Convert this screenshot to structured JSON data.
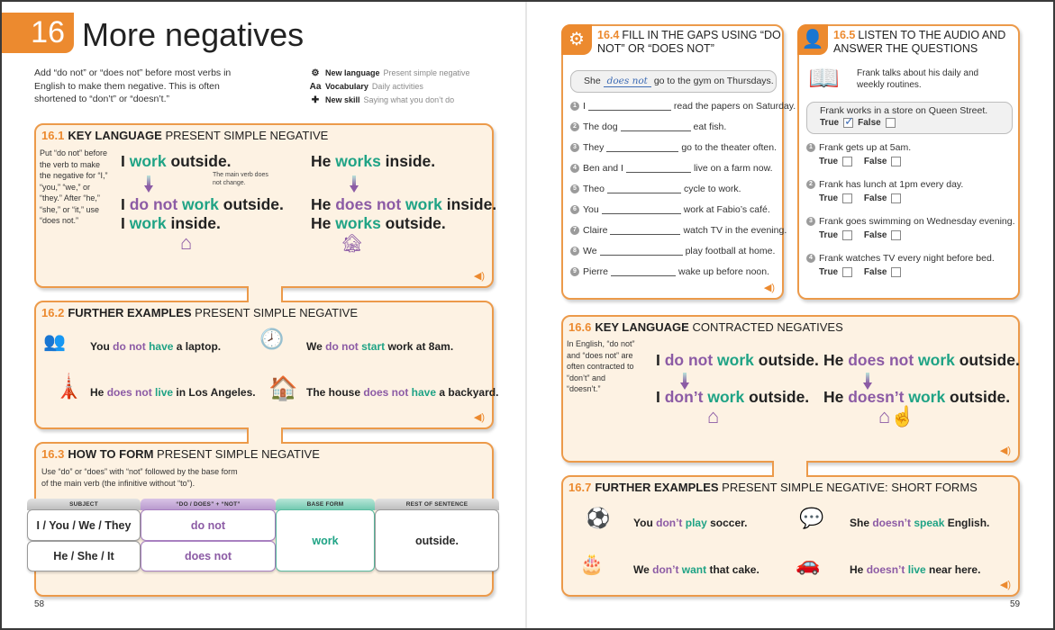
{
  "header": {
    "chapter_number": "16",
    "chapter_title": "More negatives",
    "intro": "Add “do not” or “does not” before most verbs in English to make them negative. This is often shortened to “don’t” or “doesn’t.”",
    "meta": [
      {
        "icon": "gears-icon",
        "glyph": "⚙",
        "label": "New language",
        "value": "Present simple negative"
      },
      {
        "icon": "vocabulary-icon",
        "glyph": "Aa",
        "label": "Vocabulary",
        "value": "Daily activities"
      },
      {
        "icon": "puzzle-icon",
        "glyph": "✚",
        "label": "New skill",
        "value": "Saying what you don’t do"
      }
    ]
  },
  "s161": {
    "num": "16.1",
    "title_bold": "KEY LANGUAGE",
    "title_rest": "PRESENT SIMPLE NEGATIVE",
    "side": "Put “do not” before the verb to make the negative for “I,” “you,” “we,” or “they.” After “he,” “she,” or “it,” use “does not.”",
    "note": "The main verb does not change.",
    "left": {
      "pos": {
        "a": "I ",
        "b": "work",
        "c": " outside."
      },
      "neg": {
        "a": "I ",
        "p": "do not",
        "b": " work",
        "c": " outside."
      },
      "alt": {
        "a": "I ",
        "b": "work",
        "c": " inside."
      }
    },
    "right": {
      "pos": {
        "a": "He ",
        "b": "works",
        "c": " inside."
      },
      "neg": {
        "a": "He ",
        "p": "does not",
        "b": " work",
        "c": " inside."
      },
      "alt": {
        "a": "He ",
        "b": "works",
        "c": " outside."
      }
    }
  },
  "s162": {
    "num": "16.2",
    "title_bold": "FURTHER EXAMPLES",
    "title_rest": "PRESENT SIMPLE NEGATIVE",
    "examples": [
      {
        "icon": "people-laptops-icon",
        "glyph": "👥",
        "a": "You ",
        "p": "do not",
        "g": " have",
        "c": " a laptop."
      },
      {
        "icon": "office-clock-icon",
        "glyph": "🕗",
        "a": "We ",
        "p": "do not",
        "g": " start",
        "c": " work at 8am."
      },
      {
        "icon": "eiffel-tower-icon",
        "glyph": "🗼",
        "a": "He ",
        "p": "does not",
        "g": " live",
        "c": " in Los Angeles."
      },
      {
        "icon": "house-icon",
        "glyph": "🏠",
        "a": "The house ",
        "p": "does not",
        "g": " have",
        "c": " a backyard."
      }
    ]
  },
  "s163": {
    "num": "16.3",
    "title_bold": "HOW TO FORM",
    "title_rest": "PRESENT SIMPLE NEGATIVE",
    "desc": "Use “do” or “does” with “not” followed by the base form of the main verb (the infinitive without “to”).",
    "headers": [
      "SUBJECT",
      "“DO / DOES” + “NOT”",
      "BASE FORM",
      "REST OF SENTENCE"
    ],
    "subjects": [
      "I / You / We / They",
      "He / She / It"
    ],
    "auxiliaries": [
      "do not",
      "does not"
    ],
    "base": "work",
    "rest": "outside."
  },
  "s164": {
    "num": "16.4",
    "title": "FILL IN THE GAPS USING “DO NOT” OR “DOES NOT”",
    "example": {
      "a": "She",
      "answer": "does not",
      "c": "go to the gym on Thursdays."
    },
    "questions": [
      {
        "n": "1",
        "a": "I",
        "c": "read the papers on Saturday."
      },
      {
        "n": "2",
        "a": "The dog",
        "c": "eat fish."
      },
      {
        "n": "3",
        "a": "They",
        "c": "go to the theater often."
      },
      {
        "n": "4",
        "a": "Ben and I",
        "c": "live on a farm now."
      },
      {
        "n": "5",
        "a": "Theo",
        "c": "cycle to work."
      },
      {
        "n": "6",
        "a": "You",
        "c": "work at Fabio’s café."
      },
      {
        "n": "7",
        "a": "Claire",
        "c": "watch TV in the evening."
      },
      {
        "n": "8",
        "a": "We",
        "c": "play football at home."
      },
      {
        "n": "9",
        "a": "Pierre",
        "c": "wake up before noon."
      }
    ]
  },
  "s165": {
    "num": "16.5",
    "title": "LISTEN TO THE AUDIO AND ANSWER THE QUESTIONS",
    "intro": "Frank talks about his daily and weekly routines.",
    "true_label": "True",
    "false_label": "False",
    "example": {
      "text": "Frank works in a store on Queen Street.",
      "true_checked": true,
      "false_checked": false
    },
    "questions": [
      {
        "n": "1",
        "text": "Frank gets up at 5am."
      },
      {
        "n": "2",
        "text": "Frank has lunch at 1pm every day."
      },
      {
        "n": "3",
        "text": "Frank goes swimming on Wednesday evening."
      },
      {
        "n": "4",
        "text": "Frank watches TV every night before bed."
      }
    ]
  },
  "s166": {
    "num": "16.6",
    "title_bold": "KEY LANGUAGE",
    "title_rest": "CONTRACTED NEGATIVES",
    "side": "In English, “do not” and “does not” are often contracted to “don’t” and “doesn’t.”",
    "left": {
      "full": {
        "a": "I ",
        "p": "do not",
        "g": " work",
        "c": " outside."
      },
      "short": {
        "a": "I ",
        "p": "don’t",
        "g": " work",
        "c": " outside."
      }
    },
    "right": {
      "full": {
        "a": "He ",
        "p": "does not",
        "g": " work",
        "c": " outside."
      },
      "short": {
        "a": "He ",
        "p": "doesn’t",
        "g": " work",
        "c": " outside."
      }
    }
  },
  "s167": {
    "num": "16.7",
    "title_bold": "FURTHER EXAMPLES",
    "title_rest": "PRESENT SIMPLE NEGATIVE: SHORT FORMS",
    "examples": [
      {
        "icon": "soccer-players-icon",
        "glyph": "⚽",
        "a": "You ",
        "p": "don’t",
        "g": " play",
        "c": " soccer."
      },
      {
        "icon": "speaking-people-icon",
        "glyph": "💬",
        "a": "She ",
        "p": "doesn’t",
        "g": " speak",
        "c": " English."
      },
      {
        "icon": "cake-people-icon",
        "glyph": "🎂",
        "a": "We ",
        "p": "don’t",
        "g": " want",
        "c": " that cake."
      },
      {
        "icon": "couple-car-icon",
        "glyph": "🚗",
        "a": "He ",
        "p": "doesn’t",
        "g": " live",
        "c": " near here."
      }
    ]
  },
  "pages": {
    "left": "58",
    "right": "59"
  },
  "colors": {
    "accent": "#ec8a2f",
    "purple": "#8c5ba5",
    "green": "#1fa385",
    "panel_bg": "#fdf2e3"
  }
}
